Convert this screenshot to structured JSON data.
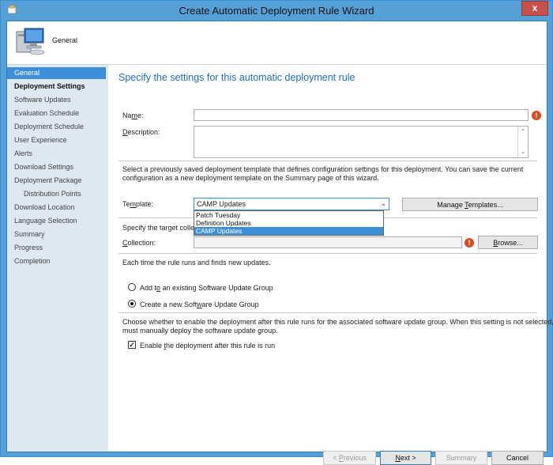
{
  "window": {
    "title": "Create Automatic Deployment Rule Wizard",
    "close_glyph": "x"
  },
  "header": {
    "title": "General"
  },
  "sidebar": {
    "items": [
      {
        "label": "General",
        "state": "active"
      },
      {
        "label": "Deployment Settings",
        "state": "bold"
      },
      {
        "label": "Software Updates",
        "state": "normal"
      },
      {
        "label": "Evaluation Schedule",
        "state": "normal"
      },
      {
        "label": "Deployment Schedule",
        "state": "normal"
      },
      {
        "label": "User Experience",
        "state": "normal"
      },
      {
        "label": "Alerts",
        "state": "normal"
      },
      {
        "label": "Download Settings",
        "state": "normal"
      },
      {
        "label": "Deployment Package",
        "state": "normal"
      },
      {
        "label": "Distribution Points",
        "state": "sub"
      },
      {
        "label": "Download Location",
        "state": "normal"
      },
      {
        "label": "Language Selection",
        "state": "normal"
      },
      {
        "label": "Summary",
        "state": "normal"
      },
      {
        "label": "Progress",
        "state": "normal"
      },
      {
        "label": "Completion",
        "state": "normal"
      }
    ]
  },
  "main": {
    "heading": "Specify the settings for this automatic deployment rule",
    "name": {
      "label_pre": "Na",
      "label_u": "m",
      "label_post": "e:",
      "value": ""
    },
    "description": {
      "label_u": "D",
      "label_post": "escription:",
      "value": ""
    },
    "template_info_line1": "Select a previously saved deployment template that defines configuration settings for this deployment. You can save the current",
    "template_info_line2": "configuration as a new deployment template on the Summary page of this wizard.",
    "template": {
      "label_pre": "Te",
      "label_u": "m",
      "label_post": "plate:",
      "selected": "CAMP Updates",
      "options": [
        "Patch Tuesday",
        "Definition Updates",
        "CAMP Updates"
      ],
      "manage_button": {
        "pre": "Manage ",
        "u": "T",
        "post": "emplates..."
      }
    },
    "target_text": "Specify the target collec",
    "collection": {
      "label_u": "C",
      "label_post": "ollection:",
      "value": "",
      "browse": {
        "u": "B",
        "post": "rowse..."
      }
    },
    "rule_runs_text": "Each time the rule runs and finds new updates.",
    "radio_existing": {
      "pre": "Add t",
      "u": "o",
      "post": " an existing Software Update Group",
      "checked": false
    },
    "radio_new": {
      "pre": "Create a new Soft",
      "u": "w",
      "post": "are Update Group",
      "checked": true
    },
    "enable_info_line1": "Choose whether to enable the deployment after this rule runs for the associated software update group. When this setting is not selected, you",
    "enable_info_line2": "must manually deploy the software update group.",
    "enable_checkbox": {
      "pre": "Enable ",
      "u": "t",
      "post": "he deployment after this rule is run",
      "checked": true,
      "glyph": "✓"
    }
  },
  "footer": {
    "previous": {
      "pre": "< ",
      "u": "P",
      "post": "revious"
    },
    "next": {
      "u": "N",
      "post": "ext >"
    },
    "summary": "Summary",
    "cancel": "Cancel"
  },
  "icons": {
    "error_glyph": "!"
  }
}
